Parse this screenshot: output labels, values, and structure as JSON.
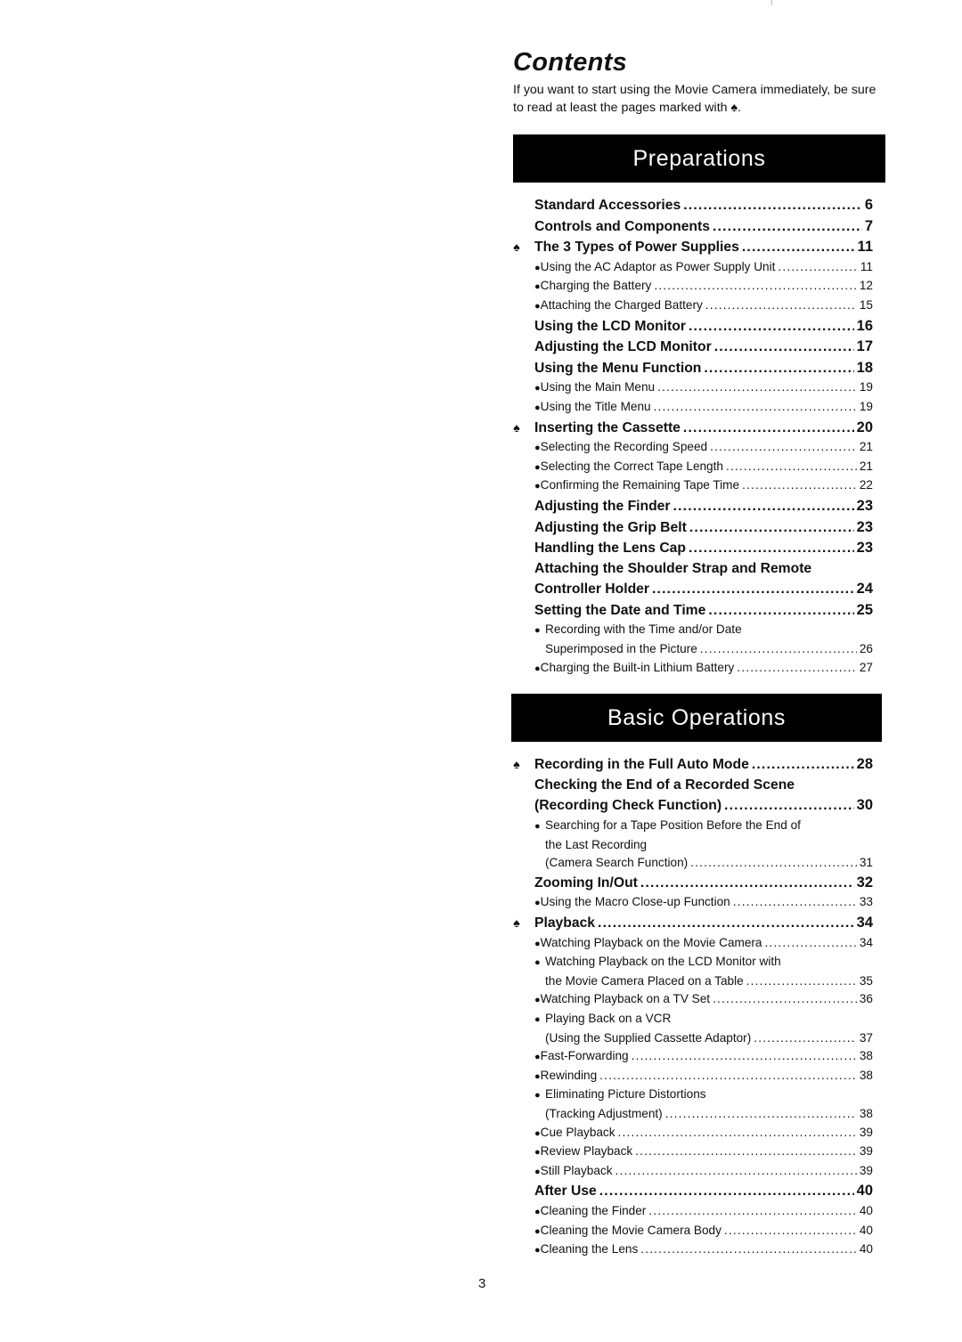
{
  "document": {
    "title": "Contents",
    "intro": "If you want to start using the Movie Camera immediately, be sure to read at least the pages marked with ♠.",
    "marker_icon": "spade-icon",
    "page_number": "3"
  },
  "sections": [
    {
      "heading": "Preparations",
      "entries": [
        {
          "type": "main",
          "lines": [
            "Standard Accessories"
          ],
          "page": "6",
          "marked": false
        },
        {
          "type": "main",
          "lines": [
            "Controls and Components"
          ],
          "page": "7",
          "marked": false
        },
        {
          "type": "main",
          "lines": [
            "The 3 Types of Power Supplies"
          ],
          "page": "11",
          "marked": true
        },
        {
          "type": "sub",
          "lines": [
            "Using the AC Adaptor as Power Supply Unit"
          ],
          "page": "11"
        },
        {
          "type": "sub",
          "lines": [
            "Charging the Battery"
          ],
          "page": "12"
        },
        {
          "type": "sub",
          "lines": [
            "Attaching the Charged Battery"
          ],
          "page": "15"
        },
        {
          "type": "main",
          "lines": [
            "Using the LCD Monitor"
          ],
          "page": "16",
          "marked": false
        },
        {
          "type": "main",
          "lines": [
            "Adjusting the LCD Monitor"
          ],
          "page": "17",
          "marked": false
        },
        {
          "type": "main",
          "lines": [
            "Using the Menu Function"
          ],
          "page": "18",
          "marked": false
        },
        {
          "type": "sub",
          "lines": [
            "Using the Main Menu"
          ],
          "page": "19"
        },
        {
          "type": "sub",
          "lines": [
            "Using the Title Menu"
          ],
          "page": "19"
        },
        {
          "type": "main",
          "lines": [
            "Inserting the Cassette"
          ],
          "page": "20",
          "marked": true
        },
        {
          "type": "sub",
          "lines": [
            "Selecting the Recording Speed"
          ],
          "page": "21"
        },
        {
          "type": "sub",
          "lines": [
            "Selecting the Correct Tape Length"
          ],
          "page": "21"
        },
        {
          "type": "sub",
          "lines": [
            "Confirming the Remaining Tape Time"
          ],
          "page": "22"
        },
        {
          "type": "main",
          "lines": [
            "Adjusting the Finder"
          ],
          "page": "23",
          "marked": false
        },
        {
          "type": "main",
          "lines": [
            "Adjusting the Grip Belt"
          ],
          "page": "23",
          "marked": false
        },
        {
          "type": "main",
          "lines": [
            "Handling the Lens Cap"
          ],
          "page": "23",
          "marked": false
        },
        {
          "type": "main",
          "lines": [
            "Attaching the Shoulder Strap and Remote",
            "Controller Holder"
          ],
          "page": "24",
          "marked": false
        },
        {
          "type": "main",
          "lines": [
            "Setting the Date and Time"
          ],
          "page": "25",
          "marked": false
        },
        {
          "type": "sub",
          "lines": [
            "Recording with the Time and/or Date",
            "Superimposed in the Picture"
          ],
          "page": "26"
        },
        {
          "type": "sub",
          "lines": [
            "Charging the Built-in Lithium Battery"
          ],
          "page": "27"
        }
      ]
    },
    {
      "heading": "Basic Operations",
      "entries": [
        {
          "type": "main",
          "lines": [
            "Recording in the Full Auto Mode"
          ],
          "page": "28",
          "marked": true
        },
        {
          "type": "main",
          "lines": [
            "Checking the End of a Recorded Scene",
            "(Recording Check Function)"
          ],
          "page": "30",
          "marked": false
        },
        {
          "type": "sub",
          "lines": [
            "Searching for a Tape Position Before the End of",
            "the Last Recording",
            "(Camera Search Function)"
          ],
          "page": "31"
        },
        {
          "type": "main",
          "lines": [
            "Zooming In/Out"
          ],
          "page": "32",
          "marked": false
        },
        {
          "type": "sub",
          "lines": [
            "Using the Macro Close-up Function"
          ],
          "page": "33"
        },
        {
          "type": "main",
          "lines": [
            "Playback"
          ],
          "page": "34",
          "marked": true
        },
        {
          "type": "sub",
          "lines": [
            "Watching Playback on the Movie Camera"
          ],
          "page": "34"
        },
        {
          "type": "sub",
          "lines": [
            "Watching Playback on the LCD Monitor with",
            "the Movie Camera Placed on a Table"
          ],
          "page": "35"
        },
        {
          "type": "sub",
          "lines": [
            "Watching Playback on a TV Set"
          ],
          "page": "36"
        },
        {
          "type": "sub",
          "lines": [
            "Playing Back on a VCR",
            "(Using the Supplied Cassette Adaptor)"
          ],
          "page": "37"
        },
        {
          "type": "sub",
          "lines": [
            "Fast-Forwarding"
          ],
          "page": "38"
        },
        {
          "type": "sub",
          "lines": [
            "Rewinding"
          ],
          "page": "38"
        },
        {
          "type": "sub",
          "lines": [
            "Eliminating Picture Distortions",
            "(Tracking Adjustment)"
          ],
          "page": "38"
        },
        {
          "type": "sub",
          "lines": [
            "Cue Playback"
          ],
          "page": "39"
        },
        {
          "type": "sub",
          "lines": [
            "Review Playback"
          ],
          "page": "39"
        },
        {
          "type": "sub",
          "lines": [
            "Still Playback"
          ],
          "page": "39"
        },
        {
          "type": "main",
          "lines": [
            "After Use"
          ],
          "page": "40",
          "marked": false
        },
        {
          "type": "sub",
          "lines": [
            "Cleaning the Finder"
          ],
          "page": "40"
        },
        {
          "type": "sub",
          "lines": [
            "Cleaning the Movie Camera Body"
          ],
          "page": "40"
        },
        {
          "type": "sub",
          "lines": [
            "Cleaning the Lens"
          ],
          "page": "40"
        }
      ]
    }
  ]
}
